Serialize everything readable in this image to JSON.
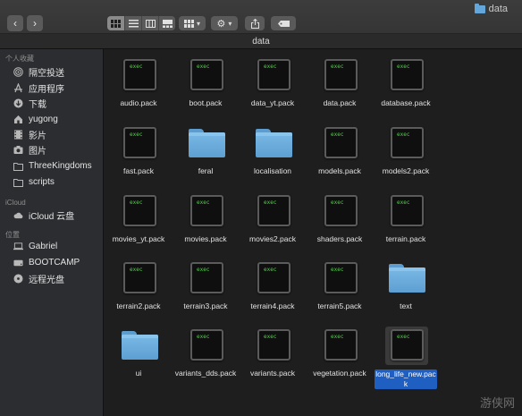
{
  "window": {
    "title": "data",
    "title_icon": "folder-icon"
  },
  "toolbar": {
    "back_icon": "‹",
    "forward_icon": "›",
    "view_modes": [
      "icon-view",
      "list-view",
      "column-view",
      "gallery-view"
    ],
    "group_button": "group-icon",
    "action_button": "gear-icon",
    "share_button": "share-icon",
    "tag_button": "tag-icon"
  },
  "pathbar": {
    "label": "data"
  },
  "sidebar": {
    "favorites_header": "个人收藏",
    "favorites": [
      {
        "label": "隔空投送",
        "icon": "airdrop-icon"
      },
      {
        "label": "应用程序",
        "icon": "applications-icon"
      },
      {
        "label": "下载",
        "icon": "downloads-icon"
      },
      {
        "label": "yugong",
        "icon": "home-icon"
      },
      {
        "label": "影片",
        "icon": "movies-icon"
      },
      {
        "label": "图片",
        "icon": "pictures-icon"
      },
      {
        "label": "ThreeKingdoms",
        "icon": "folder-icon"
      },
      {
        "label": "scripts",
        "icon": "folder-icon"
      }
    ],
    "icloud_header": "iCloud",
    "icloud": [
      {
        "label": "iCloud 云盘",
        "icon": "cloud-icon"
      }
    ],
    "locations_header": "位置",
    "locations": [
      {
        "label": "Gabriel",
        "icon": "laptop-icon"
      },
      {
        "label": "BOOTCAMP",
        "icon": "disk-icon"
      },
      {
        "label": "远程光盘",
        "icon": "optical-disc-icon"
      }
    ]
  },
  "exec_text": "exec",
  "files": [
    {
      "name": "audio.pack",
      "kind": "exec"
    },
    {
      "name": "boot.pack",
      "kind": "exec"
    },
    {
      "name": "data_yt.pack",
      "kind": "exec"
    },
    {
      "name": "data.pack",
      "kind": "exec"
    },
    {
      "name": "database.pack",
      "kind": "exec"
    },
    {
      "name": "fast.pack",
      "kind": "exec"
    },
    {
      "name": "feral",
      "kind": "folder"
    },
    {
      "name": "localisation",
      "kind": "folder"
    },
    {
      "name": "models.pack",
      "kind": "exec"
    },
    {
      "name": "models2.pack",
      "kind": "exec"
    },
    {
      "name": "movies_yt.pack",
      "kind": "exec"
    },
    {
      "name": "movies.pack",
      "kind": "exec"
    },
    {
      "name": "movies2.pack",
      "kind": "exec"
    },
    {
      "name": "shaders.pack",
      "kind": "exec"
    },
    {
      "name": "terrain.pack",
      "kind": "exec"
    },
    {
      "name": "terrain2.pack",
      "kind": "exec"
    },
    {
      "name": "terrain3.pack",
      "kind": "exec"
    },
    {
      "name": "terrain4.pack",
      "kind": "exec"
    },
    {
      "name": "terrain5.pack",
      "kind": "exec"
    },
    {
      "name": "text",
      "kind": "folder"
    },
    {
      "name": "ui",
      "kind": "folder"
    },
    {
      "name": "variants_dds.pack",
      "kind": "exec"
    },
    {
      "name": "variants.pack",
      "kind": "exec"
    },
    {
      "name": "vegetation.pack",
      "kind": "exec"
    },
    {
      "name": "long_life_new.pack",
      "kind": "exec",
      "selected": true
    }
  ],
  "watermark": "游侠网",
  "colors": {
    "folder": "#6aabdc",
    "selection": "#1f5fc2",
    "exec_text": "#52d24a"
  }
}
